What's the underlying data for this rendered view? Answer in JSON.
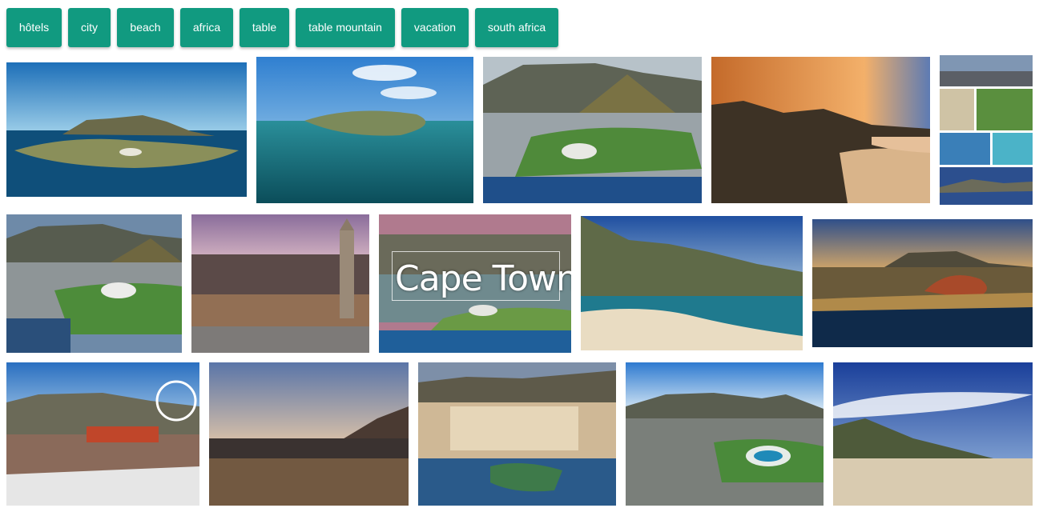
{
  "tags": [
    "hôtels",
    "city",
    "beach",
    "africa",
    "table",
    "table mountain",
    "vacation",
    "south africa"
  ],
  "overlay": {
    "title": "Cape Town"
  },
  "colors": {
    "chip_bg": "#119a80",
    "chip_text": "#ffffff"
  },
  "images": [
    "aerial-cape-town-peninsula-photo",
    "aerial-cape-town-clouds-photo",
    "aerial-stadium-table-mountain-photo",
    "sunset-coastal-mountains-photo",
    "cape-town-collage-photo",
    "stadium-aerial-photo",
    "city-dusk-clock-tower-photo",
    "cape-town-postcard-photo",
    "twelve-apostles-beach-photo",
    "aerial-city-evening-photo",
    "waterfront-ferris-wheel-photo",
    "city-lights-dusk-photo",
    "waterfront-hotel-evening-photo",
    "aerial-stadium-city-photo",
    "beach-mountains-clouds-photo"
  ]
}
